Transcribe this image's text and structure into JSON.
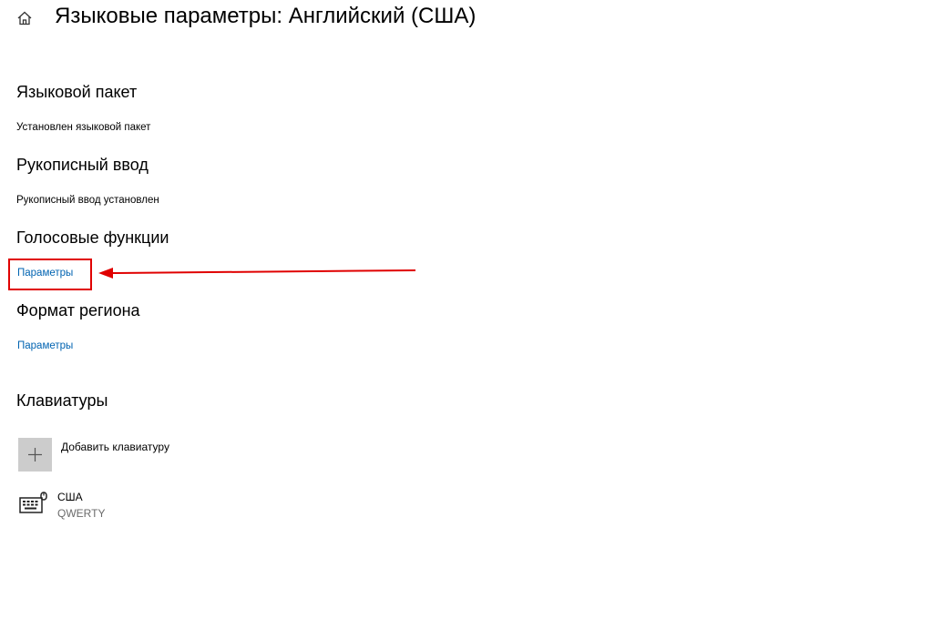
{
  "header": {
    "home_icon": "home-icon",
    "title": "Языковые параметры: Английский (США)"
  },
  "sections": {
    "language_pack": {
      "heading": "Языковой пакет",
      "status": "Установлен языковой пакет"
    },
    "handwriting": {
      "heading": "Рукописный ввод",
      "status": "Рукописный ввод установлен"
    },
    "speech": {
      "heading": "Голосовые функции",
      "link": "Параметры"
    },
    "region_format": {
      "heading": "Формат региона",
      "link": "Параметры"
    },
    "keyboards": {
      "heading": "Клавиатуры",
      "add_label": "Добавить клавиатуру",
      "items": [
        {
          "name": "США",
          "layout": "QWERTY",
          "icon": "keyboard-icon"
        }
      ]
    }
  },
  "colors": {
    "link": "#0063b1",
    "annotation": "#e00000",
    "add_button_bg": "#cccccc"
  }
}
